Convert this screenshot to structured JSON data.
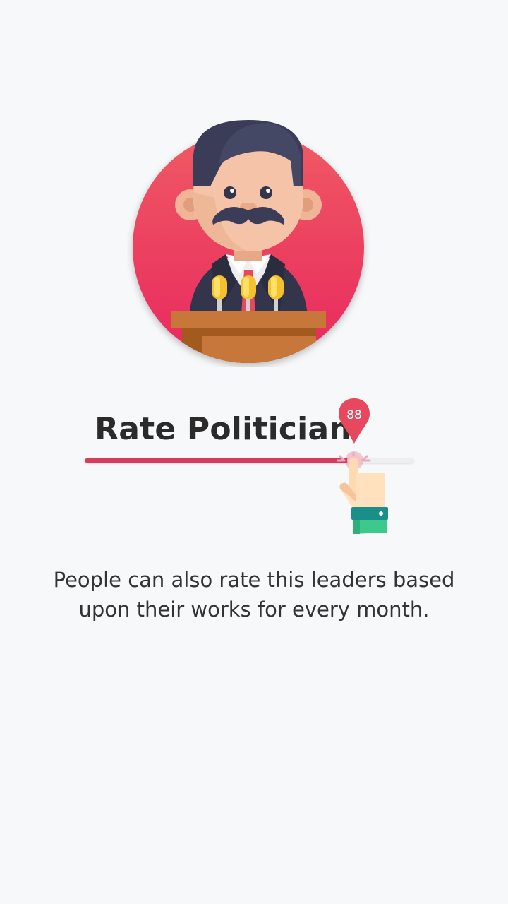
{
  "illustration": {
    "icon": "politician-at-podium-icon",
    "circle_gradient": [
      "#f05a64",
      "#e8285e"
    ]
  },
  "rating": {
    "title": "Rate Politician",
    "value": "88",
    "fraction": 0.82,
    "fill_color": "#d83c5c",
    "pointer_icon": "hand-pointer-icon"
  },
  "description": {
    "text": "People can also rate this leaders based upon their works for every month."
  }
}
